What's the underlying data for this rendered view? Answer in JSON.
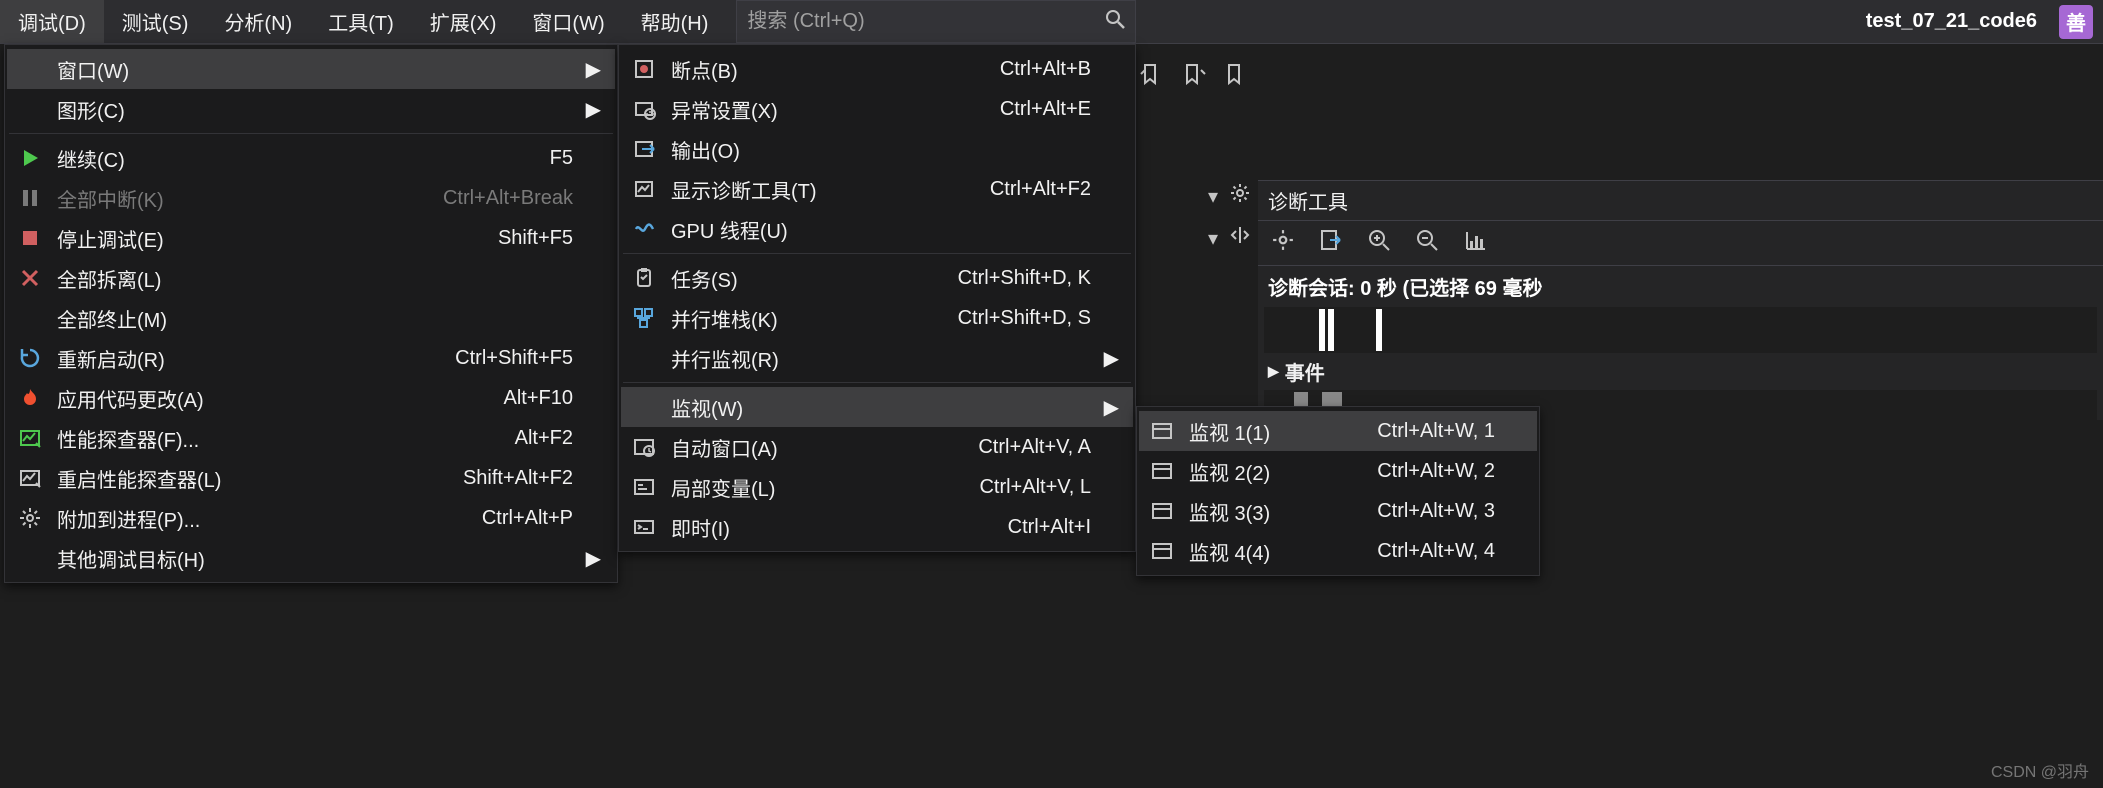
{
  "menubar": {
    "items": [
      "调试(D)",
      "测试(S)",
      "分析(N)",
      "工具(T)",
      "扩展(X)",
      "窗口(W)",
      "帮助(H)"
    ]
  },
  "search": {
    "placeholder": "搜索 (Ctrl+Q)"
  },
  "project": {
    "name": "test_07_21_code6",
    "avatar": "善"
  },
  "debug_menu": [
    {
      "icon": "",
      "label": "窗口(W)",
      "shortcut": "",
      "sub": true,
      "sep": false,
      "highlight": true
    },
    {
      "icon": "",
      "label": "图形(C)",
      "shortcut": "",
      "sub": true,
      "sep": true
    },
    {
      "icon": "play",
      "label": "继续(C)",
      "shortcut": "F5",
      "sep": false
    },
    {
      "icon": "pause",
      "label": "全部中断(K)",
      "shortcut": "Ctrl+Alt+Break",
      "disabled": true,
      "sep": false
    },
    {
      "icon": "stop",
      "label": "停止调试(E)",
      "shortcut": "Shift+F5",
      "sep": false
    },
    {
      "icon": "x",
      "label": "全部拆离(L)",
      "shortcut": "",
      "sep": false
    },
    {
      "icon": "",
      "label": "全部终止(M)",
      "shortcut": "",
      "sep": false
    },
    {
      "icon": "restart",
      "label": "重新启动(R)",
      "shortcut": "Ctrl+Shift+F5",
      "sep": false
    },
    {
      "icon": "fire",
      "label": "应用代码更改(A)",
      "shortcut": "Alt+F10",
      "sep": false
    },
    {
      "icon": "perf",
      "label": "性能探查器(F)...",
      "shortcut": "Alt+F2",
      "sep": false
    },
    {
      "icon": "perf2",
      "label": "重启性能探查器(L)",
      "shortcut": "Shift+Alt+F2",
      "sep": false
    },
    {
      "icon": "gear",
      "label": "附加到进程(P)...",
      "shortcut": "Ctrl+Alt+P",
      "sep": false
    },
    {
      "icon": "",
      "label": "其他调试目标(H)",
      "shortcut": "",
      "sub": true,
      "sep": false
    }
  ],
  "windows_menu": [
    {
      "icon": "bp",
      "label": "断点(B)",
      "shortcut": "Ctrl+Alt+B"
    },
    {
      "icon": "exc",
      "label": "异常设置(X)",
      "shortcut": "Ctrl+Alt+E"
    },
    {
      "icon": "out",
      "label": "输出(O)",
      "shortcut": ""
    },
    {
      "icon": "diag",
      "label": "显示诊断工具(T)",
      "shortcut": "Ctrl+Alt+F2"
    },
    {
      "icon": "gpu",
      "label": "GPU 线程(U)",
      "shortcut": "",
      "sep": true
    },
    {
      "icon": "task",
      "label": "任务(S)",
      "shortcut": "Ctrl+Shift+D, K"
    },
    {
      "icon": "stack",
      "label": "并行堆栈(K)",
      "shortcut": "Ctrl+Shift+D, S"
    },
    {
      "icon": "",
      "label": "并行监视(R)",
      "shortcut": "",
      "sub": true,
      "sep": true
    },
    {
      "icon": "",
      "label": "监视(W)",
      "shortcut": "",
      "sub": true,
      "highlight": true
    },
    {
      "icon": "auto",
      "label": "自动窗口(A)",
      "shortcut": "Ctrl+Alt+V, A"
    },
    {
      "icon": "loc",
      "label": "局部变量(L)",
      "shortcut": "Ctrl+Alt+V, L"
    },
    {
      "icon": "imm",
      "label": "即时(I)",
      "shortcut": "Ctrl+Alt+I"
    }
  ],
  "watch_menu": [
    {
      "label": "监视 1(1)",
      "shortcut": "Ctrl+Alt+W, 1",
      "highlight": true
    },
    {
      "label": "监视 2(2)",
      "shortcut": "Ctrl+Alt+W, 2"
    },
    {
      "label": "监视 3(3)",
      "shortcut": "Ctrl+Alt+W, 3"
    },
    {
      "label": "监视 4(4)",
      "shortcut": "Ctrl+Alt+W, 4"
    }
  ],
  "diag": {
    "title": "诊断工具",
    "session": "诊断会话: 0 秒 (已选择 69 毫秒",
    "events": "事件"
  },
  "watermark": "CSDN @羽舟"
}
